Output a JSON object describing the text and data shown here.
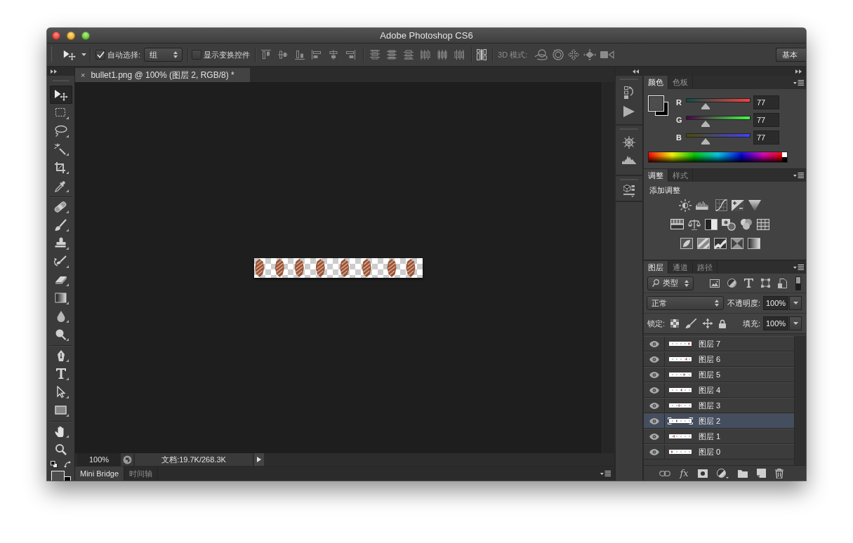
{
  "window": {
    "title": "Adobe Photoshop CS6"
  },
  "options_bar": {
    "auto_select": {
      "label": "自动选择:",
      "checked": true
    },
    "auto_select_target": "组",
    "show_transform_controls": {
      "label": "显示变换控件",
      "checked": false
    },
    "mode_3d_label": "3D 模式:",
    "workspace_button": "基本"
  },
  "toolbar": {
    "tool_groups": [
      {
        "tools": [
          {
            "kind": "move",
            "selected": true
          },
          {
            "kind": "marquee",
            "selected": false
          },
          {
            "kind": "lasso",
            "selected": false
          },
          {
            "kind": "magic_wand",
            "selected": false
          },
          {
            "kind": "crop",
            "selected": false
          },
          {
            "kind": "eyedropper",
            "selected": false
          }
        ]
      },
      {
        "tools": [
          {
            "kind": "healing_brush",
            "selected": false
          },
          {
            "kind": "brush",
            "selected": false
          },
          {
            "kind": "clone_stamp",
            "selected": false
          },
          {
            "kind": "history_brush",
            "selected": false
          },
          {
            "kind": "eraser",
            "selected": false
          },
          {
            "kind": "gradient",
            "selected": false
          },
          {
            "kind": "blur",
            "selected": false
          },
          {
            "kind": "dodge",
            "selected": false
          }
        ]
      },
      {
        "tools": [
          {
            "kind": "pen",
            "selected": false
          },
          {
            "kind": "type",
            "selected": false
          },
          {
            "kind": "path_selection",
            "selected": false
          },
          {
            "kind": "rectangle",
            "selected": false
          }
        ]
      },
      {
        "tools": [
          {
            "kind": "hand",
            "selected": false
          },
          {
            "kind": "zoom",
            "selected": false
          }
        ]
      }
    ]
  },
  "document": {
    "tab": {
      "close": "×",
      "title": "bullet1.png @ 100% (图层 2, RGB/8) *"
    },
    "status_bar": {
      "zoom": "100%",
      "info": "文档:19.7K/268.3K"
    }
  },
  "bottom_panel": {
    "tabs": [
      {
        "label": "Mini Bridge",
        "selected": true
      },
      {
        "label": "时间轴",
        "selected": false
      }
    ]
  },
  "color_panel": {
    "tabs": [
      {
        "label": "颜色",
        "selected": true
      },
      {
        "label": "色板",
        "selected": false
      }
    ],
    "channels": [
      {
        "name": "R",
        "level": 0.3,
        "value": "77"
      },
      {
        "name": "G",
        "level": 0.3,
        "value": "77"
      },
      {
        "name": "B",
        "level": 0.3,
        "value": "77"
      }
    ]
  },
  "adjustments_panel": {
    "tabs": [
      {
        "label": "调整",
        "selected": true
      },
      {
        "label": "样式",
        "selected": false
      }
    ],
    "heading": "添加调整"
  },
  "layers_panel": {
    "tabs": [
      {
        "label": "图层",
        "selected": true
      },
      {
        "label": "通道",
        "selected": false
      },
      {
        "label": "路径",
        "selected": false
      }
    ],
    "filter_kind": "类型",
    "blend_mode": "正常",
    "opacity_label": "不透明度:",
    "opacity": "100%",
    "lock_label": "锁定:",
    "fill_label": "填充:",
    "fill": "100%",
    "fx_button": "fx",
    "layers": [
      {
        "name": "图层 7",
        "visible": true,
        "selected": false
      },
      {
        "name": "图层 6",
        "visible": true,
        "selected": false
      },
      {
        "name": "图层 5",
        "visible": true,
        "selected": false
      },
      {
        "name": "图层 4",
        "visible": true,
        "selected": false
      },
      {
        "name": "图层 3",
        "visible": true,
        "selected": false
      },
      {
        "name": "图层 2",
        "visible": true,
        "selected": true
      },
      {
        "name": "图层 1",
        "visible": true,
        "selected": false
      },
      {
        "name": "图层 0",
        "visible": true,
        "selected": false
      }
    ]
  }
}
